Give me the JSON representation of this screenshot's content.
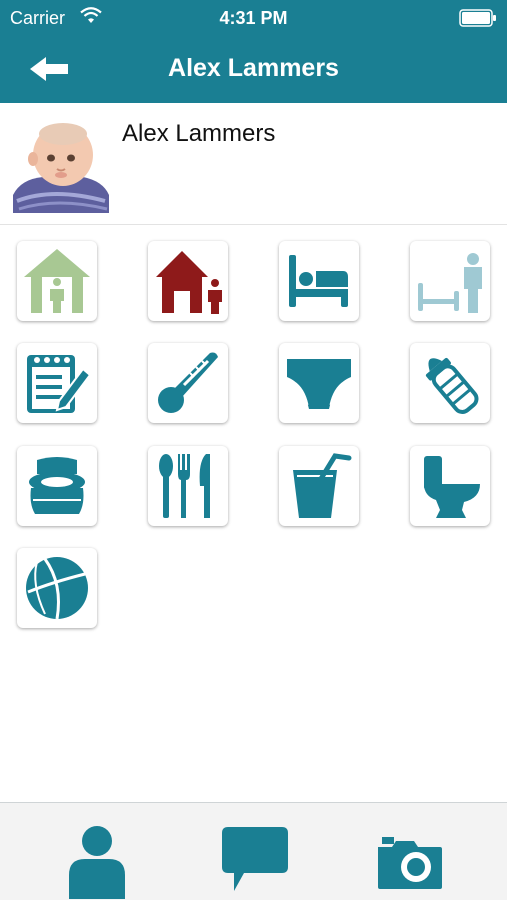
{
  "status_bar": {
    "carrier": "Carrier",
    "time": "4:31 PM",
    "wifi_icon": "wifi-icon",
    "battery_icon": "battery-icon"
  },
  "nav": {
    "title": "Alex Lammers",
    "back_icon": "back-arrow-icon"
  },
  "profile": {
    "name": "Alex Lammers",
    "avatar_icon": "baby-photo"
  },
  "colors": {
    "primary": "#1a7f93",
    "arrival_green": "#a8c893",
    "home_red": "#8e1a1a",
    "light_blue": "#9fc9d3",
    "tab_bar_bg": "#f3f3f3"
  },
  "activity_tiles": [
    {
      "icon": "arrival-house-icon"
    },
    {
      "icon": "departure-house-icon"
    },
    {
      "icon": "sleep-bed-icon"
    },
    {
      "icon": "wake-up-icon"
    },
    {
      "icon": "notepad-icon"
    },
    {
      "icon": "thermometer-icon"
    },
    {
      "icon": "diaper-icon"
    },
    {
      "icon": "baby-bottle-icon"
    },
    {
      "icon": "potty-icon"
    },
    {
      "icon": "meal-utensils-icon"
    },
    {
      "icon": "drink-cup-icon"
    },
    {
      "icon": "toilet-icon"
    },
    {
      "icon": "play-ball-icon"
    }
  ],
  "tabs": [
    {
      "icon": "profile-person-icon"
    },
    {
      "icon": "messages-chat-icon"
    },
    {
      "icon": "camera-icon"
    }
  ]
}
